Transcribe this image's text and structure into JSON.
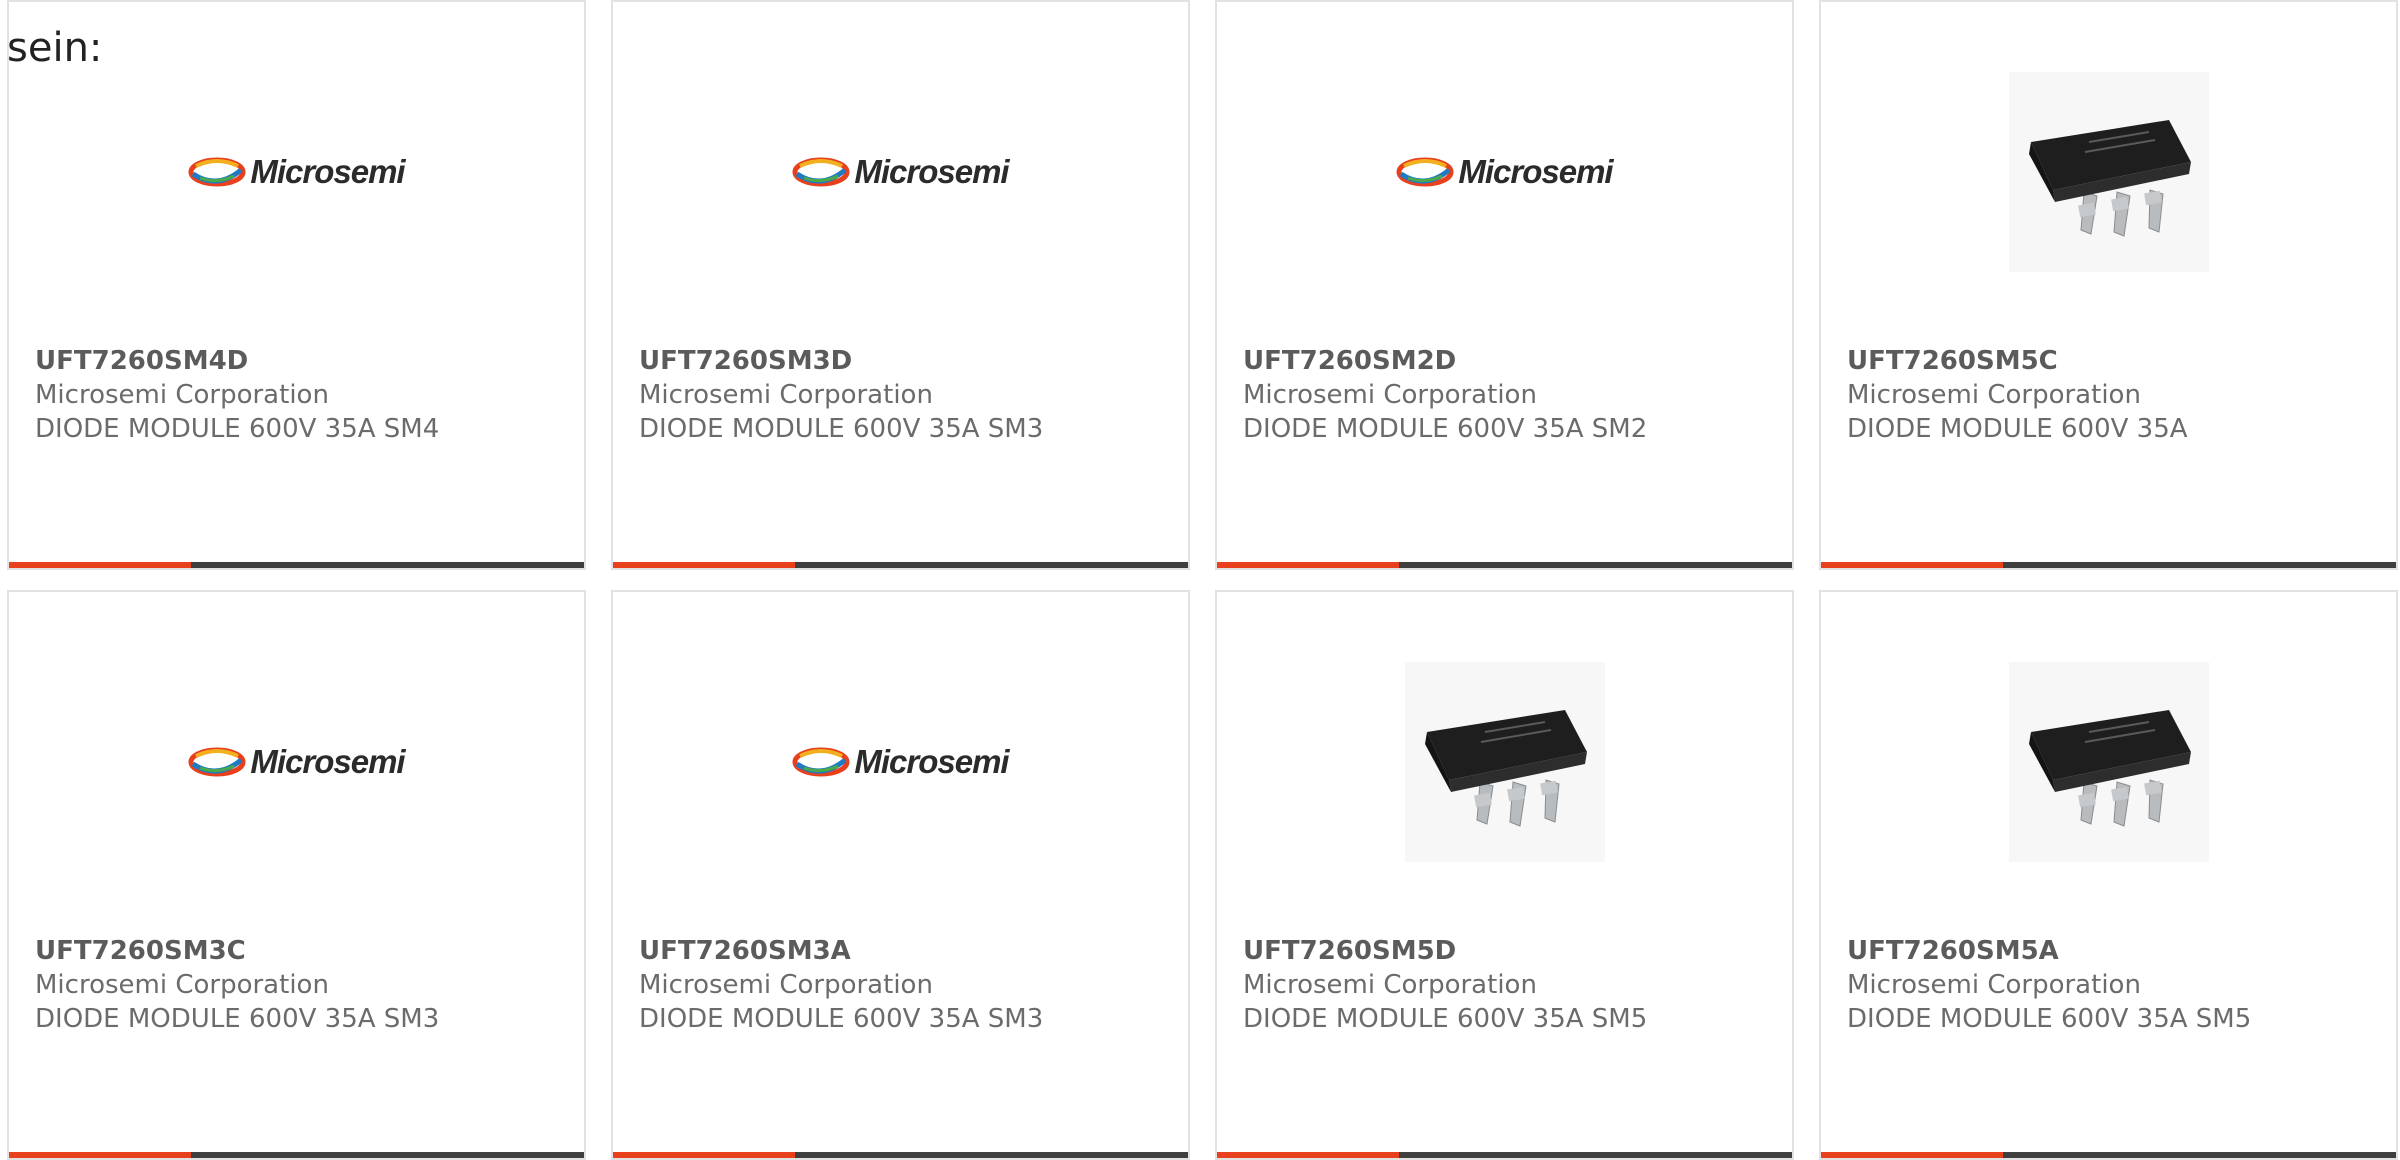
{
  "lead_text": "sein:",
  "colors": {
    "accent": "#e8401c",
    "bar": "#3f3f3f",
    "border": "#e2e2e2",
    "part_number": "#5b5b5b",
    "text": "#6b6b6b"
  },
  "products": [
    {
      "part_number": "UFT7260SM4D",
      "manufacturer": "Microsemi Corporation",
      "description": "DIODE MODULE 600V 35A SM4",
      "image": "microsemi-logo",
      "logo_text": "Microsemi"
    },
    {
      "part_number": "UFT7260SM3D",
      "manufacturer": "Microsemi Corporation",
      "description": "DIODE MODULE 600V 35A SM3",
      "image": "microsemi-logo",
      "logo_text": "Microsemi"
    },
    {
      "part_number": "UFT7260SM2D",
      "manufacturer": "Microsemi Corporation",
      "description": "DIODE MODULE 600V 35A SM2",
      "image": "microsemi-logo",
      "logo_text": "Microsemi"
    },
    {
      "part_number": "UFT7260SM5C",
      "manufacturer": "Microsemi Corporation",
      "description": "DIODE MODULE 600V 35A",
      "image": "component-photo"
    },
    {
      "part_number": "UFT7260SM3C",
      "manufacturer": "Microsemi Corporation",
      "description": "DIODE MODULE 600V 35A SM3",
      "image": "microsemi-logo",
      "logo_text": "Microsemi"
    },
    {
      "part_number": "UFT7260SM3A",
      "manufacturer": "Microsemi Corporation",
      "description": "DIODE MODULE 600V 35A SM3",
      "image": "microsemi-logo",
      "logo_text": "Microsemi"
    },
    {
      "part_number": "UFT7260SM5D",
      "manufacturer": "Microsemi Corporation",
      "description": "DIODE MODULE 600V 35A SM5",
      "image": "component-photo"
    },
    {
      "part_number": "UFT7260SM5A",
      "manufacturer": "Microsemi Corporation",
      "description": "DIODE MODULE 600V 35A SM5",
      "image": "component-photo"
    }
  ]
}
